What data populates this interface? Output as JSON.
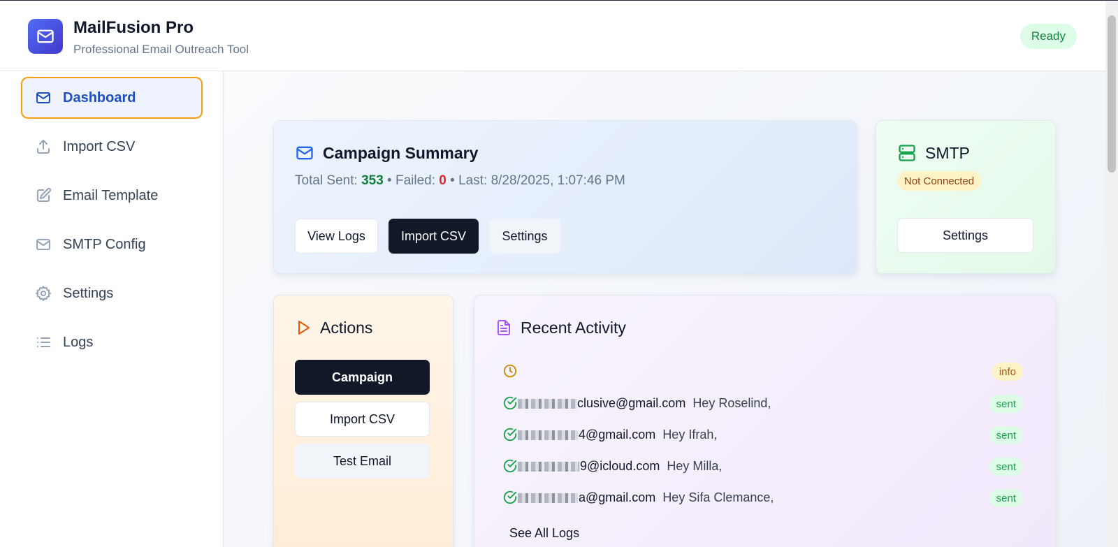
{
  "app": {
    "title": "MailFusion Pro",
    "subtitle": "Professional Email Outreach Tool",
    "status": "Ready"
  },
  "sidebar": {
    "items": [
      {
        "label": "Dashboard",
        "icon": "mail-icon",
        "active": true
      },
      {
        "label": "Import CSV",
        "icon": "upload-icon"
      },
      {
        "label": "Email Template",
        "icon": "edit-icon"
      },
      {
        "label": "SMTP Config",
        "icon": "mail-icon"
      },
      {
        "label": "Settings",
        "icon": "gear-icon"
      },
      {
        "label": "Logs",
        "icon": "list-icon"
      }
    ]
  },
  "campaign": {
    "title": "Campaign Summary",
    "total_sent_label": "Total Sent:",
    "total_sent": "353",
    "failed_label": "Failed:",
    "failed": "0",
    "last_label": "Last:",
    "last": "8/28/2025, 1:07:46 PM",
    "separator": "•",
    "buttons": {
      "view_logs": "View Logs",
      "import_csv": "Import CSV",
      "settings": "Settings"
    }
  },
  "smtp": {
    "title": "SMTP",
    "status": "Not Connected",
    "settings_button": "Settings"
  },
  "actions": {
    "title": "Actions",
    "campaign_button": "Campaign",
    "import_button": "Import CSV",
    "test_button": "Test Email"
  },
  "activity": {
    "title": "Recent Activity",
    "info_badge": "info",
    "rows": [
      {
        "email_visible": "clusive@gmail.com",
        "greeting": "Hey Roselind,",
        "status": "sent"
      },
      {
        "email_visible": "4@gmail.com",
        "greeting": "Hey Ifrah,",
        "status": "sent"
      },
      {
        "email_visible": "9@icloud.com",
        "greeting": "Hey Milla,",
        "status": "sent"
      },
      {
        "email_visible": "a@gmail.com",
        "greeting": "Hey Sifa Clemance,",
        "status": "sent"
      }
    ],
    "see_all": "See All Logs"
  },
  "colors": {
    "accent": "#4f6df5",
    "success": "#15803d",
    "danger": "#dc2626",
    "active_border": "#f59e0b"
  }
}
